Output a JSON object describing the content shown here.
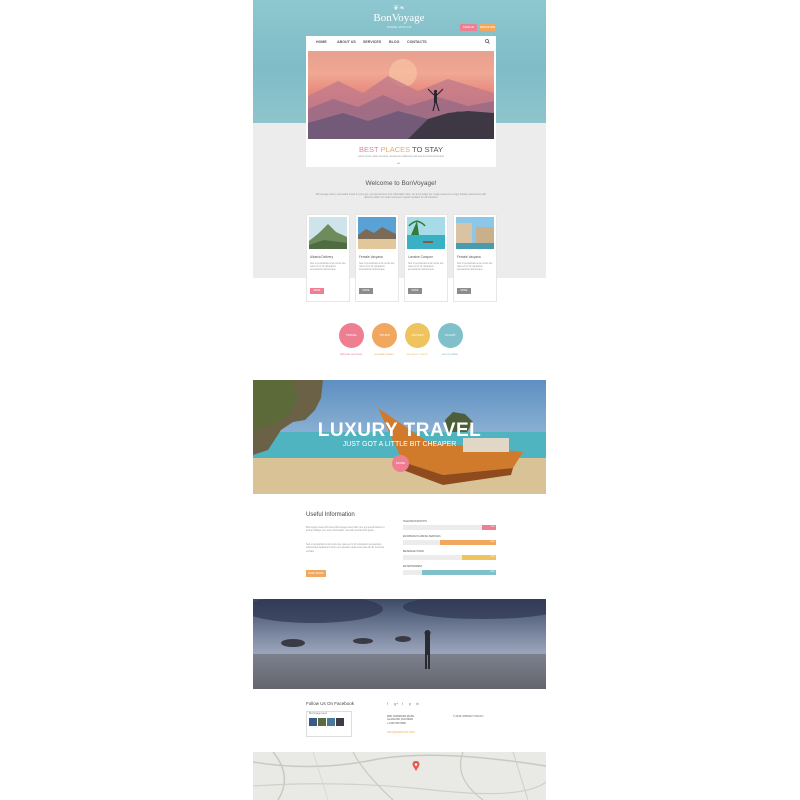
{
  "header": {
    "logo_ornament": "❦❧",
    "logo": "BonVoyage",
    "tagline": "TRAVEL WITH US",
    "sign_in": "SIGN IN",
    "register": "REGISTER"
  },
  "nav": {
    "items": [
      "HOME",
      "ABOUT US",
      "SERVICES",
      "BLOG",
      "CONTACTS"
    ],
    "search_icon": "search-icon"
  },
  "hero": {
    "title_part1": "BEST",
    "title_part2": "PLACES",
    "title_part3": "TO STAY",
    "subtitle": "Lorem ipsum dolor sit amet consectetur adipiscing elit sed do eiusmod tempor",
    "dots": "•••"
  },
  "welcome": {
    "title": "Welcome to BonVoyage!",
    "text": "Bonvoyage travel, renewable travel for pure joy, out special here from affordable rates, for any budget per single seasons to enjoy holiday adventures with discount offers for loyal customers regular updates for all travellers"
  },
  "cards": [
    {
      "title": "Albania Delivery",
      "text": "Sed ut perspiciatis unde omnis iste natus error sit voluptatem accusantium doloremque",
      "button": "MORE",
      "color": "#ee7f92"
    },
    {
      "title": "Female Vacyana",
      "text": "Sed ut perspiciatis unde omnis iste natus error sit voluptatem accusantium doloremque",
      "button": "MORE",
      "color": "#8c8c8c"
    },
    {
      "title": "Lorraine Conquer",
      "text": "Sed ut perspiciatis unde omnis iste natus error sit voluptatem accusantium doloremque",
      "button": "MORE",
      "color": "#8c8c8c"
    },
    {
      "title": "Female Vacyana",
      "text": "Sed ut perspiciatis unde omnis iste natus error sit voluptatem accusantium doloremque",
      "button": "MORE",
      "color": "#8c8c8c"
    }
  ],
  "features": [
    {
      "label": "TRAVEL",
      "caption": "ultimate services",
      "color": "#ee7f92"
    },
    {
      "label": "TOURS",
      "caption": "provider travel",
      "color": "#f1a75d"
    },
    {
      "label": "HOTELS",
      "caption": "premium rooms",
      "color": "#efc45f"
    },
    {
      "label": "FLIGHT",
      "caption": "out of coffee",
      "color": "#7fc0ca"
    }
  ],
  "luxury": {
    "title": "LUXURY TRAVEL",
    "subtitle": "JUST GOT A LITTLE BIT CHEAPER",
    "button": "MORE"
  },
  "useful": {
    "title": "Useful Information",
    "text1": "Bonvoyage travel with lorem Bonvoyage travel with pure joy special leisure to all the holidays you need. Information, rest with special hotel guide.",
    "text2": "Sed ut perspiciatis unde omnis iste natus error sit voluptatem accusantium doloremque laudantium totam rem aperiam eaque ipsa quae ab illo inventore veritatis.",
    "button": "READ MORE"
  },
  "bars": [
    {
      "label": "TELEVISION BOOTHS",
      "value": 0.15,
      "text": "15%",
      "color": "#ee7f92"
    },
    {
      "label": "EUROPEAN PLANNING SERVICES",
      "value": 0.6,
      "text": "60%",
      "color": "#f1a75d"
    },
    {
      "label": "BEVERAGE STAND",
      "value": 0.37,
      "text": "37%",
      "color": "#efc45f"
    },
    {
      "label": "ENTERTAINMENT",
      "value": 0.8,
      "text": "80%",
      "color": "#7fc0ca"
    }
  ],
  "footer": {
    "fb_title": "Follow Us On Facebook",
    "fb_page": "BonVoyage travel",
    "social_icons": [
      "facebook-icon",
      "google-plus-icon",
      "twitter-icon",
      "pinterest-icon",
      "linkedin-icon"
    ],
    "address": [
      "8901 MARMORA ROAD,",
      "GLASGOW, D04 89GR",
      "+1 800 559 6580"
    ],
    "email": "INFO@DEMOLINK.ORG",
    "copyright": "© 2015 | PRIVACY POLICY"
  }
}
